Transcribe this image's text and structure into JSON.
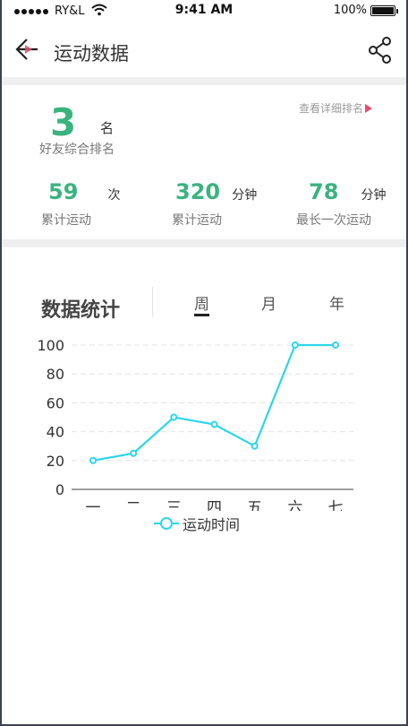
{
  "status_bar": {
    "carrier": "RY&L",
    "time": "9:41 AM",
    "battery": "100%"
  },
  "nav": {
    "title": "运动数据",
    "back_icon": "back-arrow-icon",
    "share_icon": "share-icon"
  },
  "ranking": {
    "value": "3",
    "unit": "名",
    "label": "好友综合排名",
    "detail_link": "查看详细排名"
  },
  "stats": [
    {
      "value": "59",
      "unit": "次",
      "label": "累计运动"
    },
    {
      "value": "320",
      "unit": "分钟",
      "label": "累计运动"
    },
    {
      "value": "78",
      "unit": "分钟",
      "label": "最长一次运动"
    }
  ],
  "chart_section": {
    "title": "数据统计",
    "tabs": [
      {
        "label": "周",
        "active": true
      },
      {
        "label": "月",
        "active": false
      },
      {
        "label": "年",
        "active": false
      }
    ]
  },
  "colors": {
    "accent_green": "#3bb37f",
    "line": "#2dd6ea",
    "link_arrow": "#e04d6b"
  },
  "chart_data": {
    "type": "line",
    "categories": [
      "一",
      "二",
      "三",
      "四",
      "五",
      "六",
      "七"
    ],
    "series": [
      {
        "name": "运动时间",
        "values": [
          20,
          25,
          50,
          45,
          30,
          100,
          100
        ]
      }
    ],
    "ylim": [
      0,
      100
    ],
    "yticks": [
      "0",
      "20",
      "40",
      "60",
      "80",
      "100"
    ],
    "grid": true,
    "legend": "bottom"
  }
}
